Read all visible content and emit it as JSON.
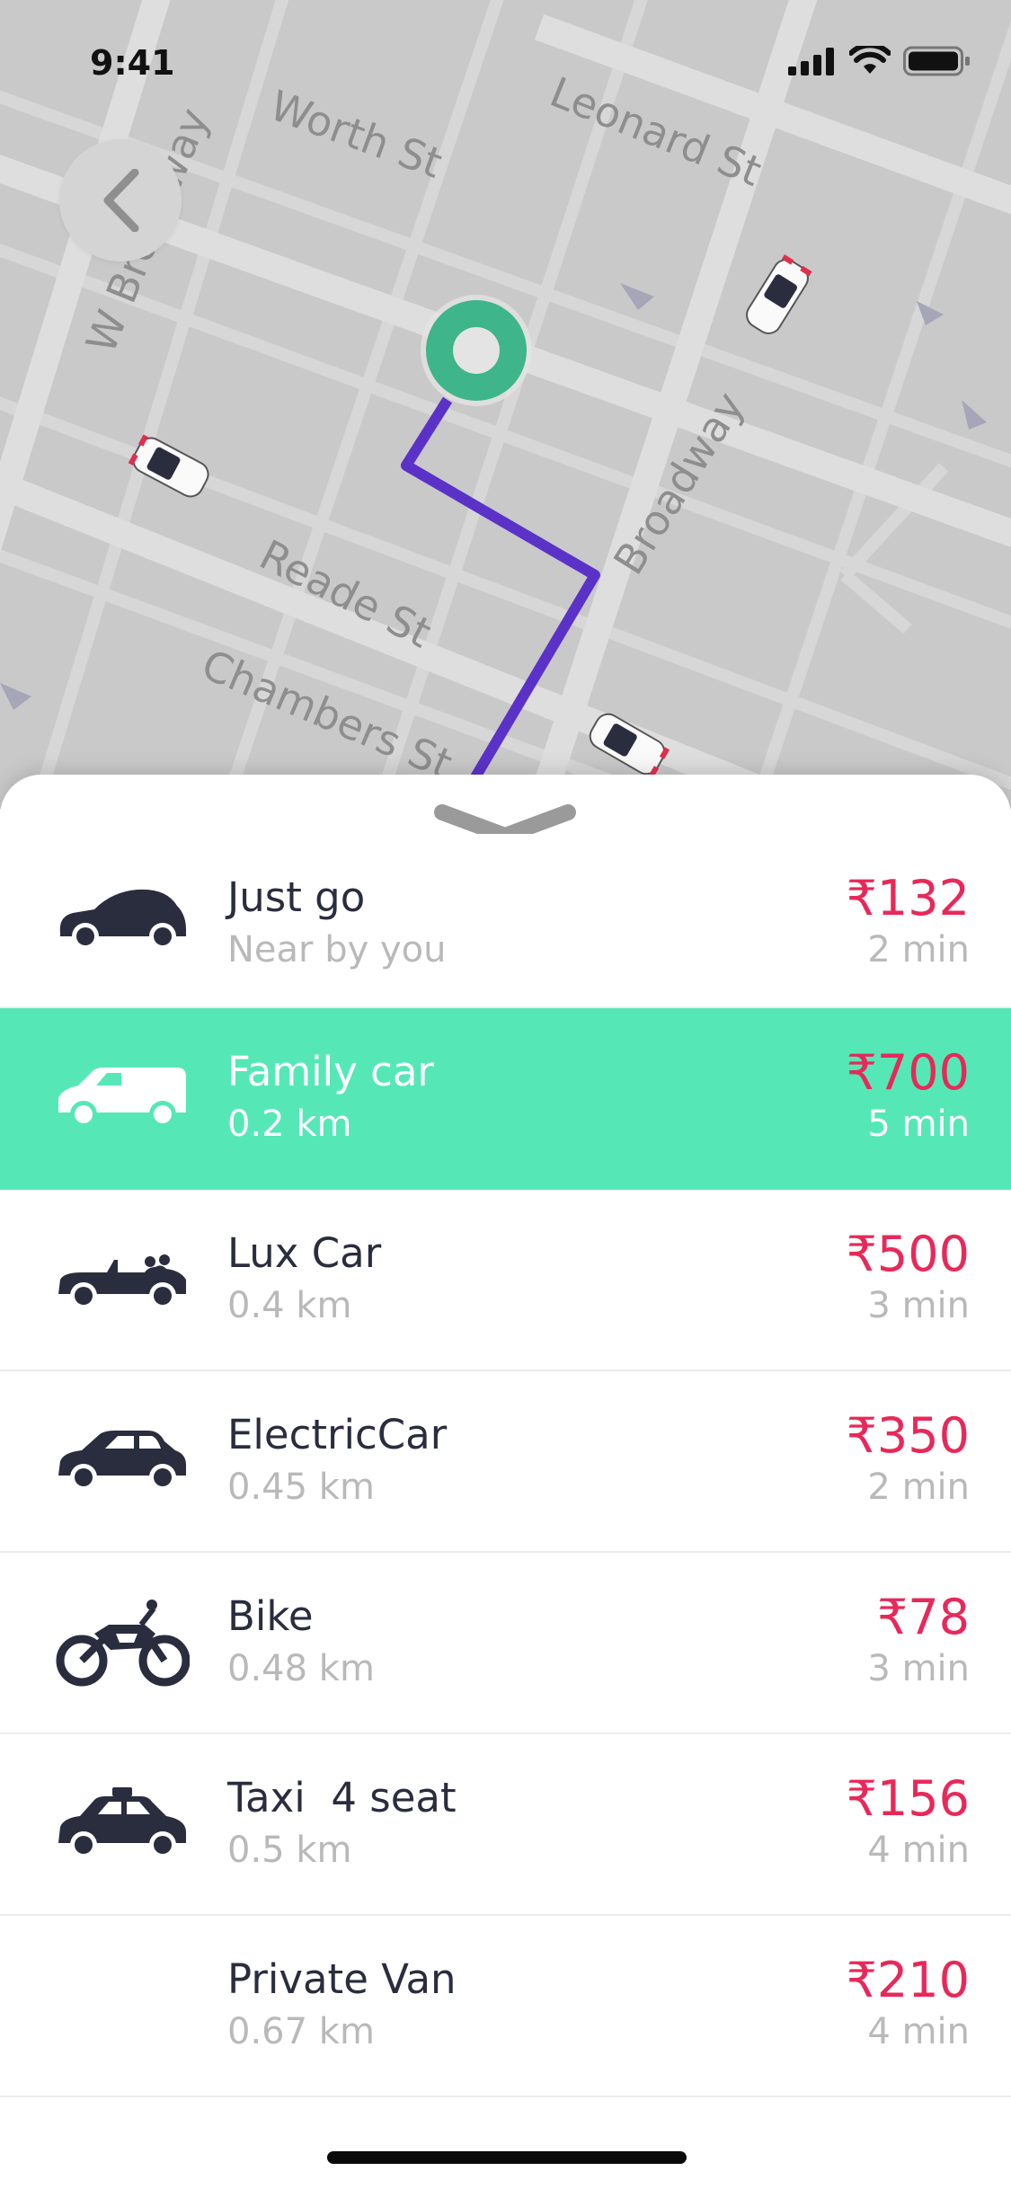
{
  "status_bar": {
    "time": "9:41"
  },
  "map": {
    "streets": [
      "Worth St",
      "Leonard St",
      "W Broadway",
      "Broadway",
      "Reade St",
      "Chambers St"
    ],
    "route_color": "#5b32c8",
    "pin_color": "#3eb58a"
  },
  "rides": [
    {
      "name": "Just go",
      "sub": "Near by you",
      "price": "₹132",
      "time": "2 min",
      "icon": "hatchback-icon",
      "selected": false
    },
    {
      "name": "Family car",
      "sub": "0.2 km",
      "price": "₹700",
      "time": "5 min",
      "icon": "van-icon",
      "selected": true
    },
    {
      "name": "Lux Car",
      "sub": "0.4 km",
      "price": "₹500",
      "time": "3 min",
      "icon": "convertible-icon",
      "selected": false
    },
    {
      "name": "ElectricCar",
      "sub": "0.45 km",
      "price": "₹350",
      "time": "2 min",
      "icon": "electric-car-icon",
      "selected": false
    },
    {
      "name": "Bike",
      "sub": "0.48 km",
      "price": "₹78",
      "time": "3 min",
      "icon": "motorbike-icon",
      "selected": false
    },
    {
      "name": "Taxi  4 seat",
      "sub": "0.5 km",
      "price": "₹156",
      "time": "4 min",
      "icon": "taxi-icon",
      "selected": false
    },
    {
      "name": "Private Van",
      "sub": "0.67 km",
      "price": "₹210",
      "time": "4 min",
      "icon": "",
      "selected": false
    }
  ],
  "colors": {
    "accent": "#55e8b6",
    "price": "#e9285a",
    "text": "#2a2d3e",
    "muted": "#b9b9b9"
  }
}
